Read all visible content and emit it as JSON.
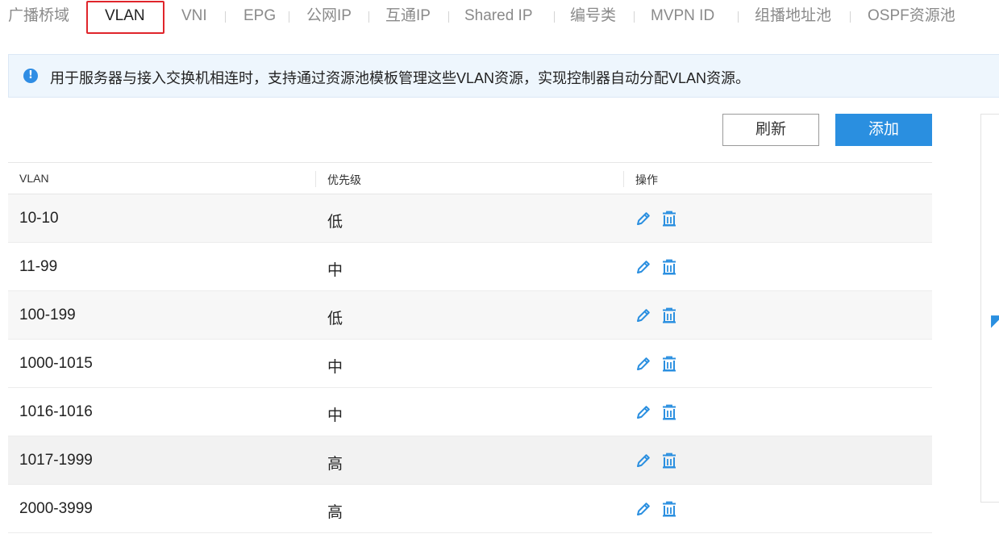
{
  "tabs": [
    {
      "label": "广播桥域",
      "active": false
    },
    {
      "label": "VLAN",
      "active": true
    },
    {
      "label": "VNI",
      "active": false
    },
    {
      "label": "EPG",
      "active": false
    },
    {
      "label": "公网IP",
      "active": false
    },
    {
      "label": "互通IP",
      "active": false
    },
    {
      "label": "Shared IP",
      "active": false
    },
    {
      "label": "编号类",
      "active": false
    },
    {
      "label": "MVPN ID",
      "active": false
    },
    {
      "label": "组播地址池",
      "active": false
    },
    {
      "label": "OSPF资源池",
      "active": false
    }
  ],
  "notice": {
    "icon": "info-icon",
    "text": "用于服务器与接入交换机相连时，支持通过资源池模板管理这些VLAN资源，实现控制器自动分配VLAN资源。"
  },
  "toolbar": {
    "refresh_label": "刷新",
    "add_label": "添加"
  },
  "table": {
    "columns": [
      "VLAN",
      "优先级",
      "操作"
    ],
    "rows": [
      {
        "vlan": "10-10",
        "priority": "低"
      },
      {
        "vlan": "11-99",
        "priority": "中"
      },
      {
        "vlan": "100-199",
        "priority": "低"
      },
      {
        "vlan": "1000-1015",
        "priority": "中"
      },
      {
        "vlan": "1016-1016",
        "priority": "中"
      },
      {
        "vlan": "1017-1999",
        "priority": "高"
      },
      {
        "vlan": "2000-3999",
        "priority": "高"
      }
    ],
    "action_icons": [
      "edit-icon",
      "delete-icon"
    ]
  },
  "colors": {
    "accent": "#2a8fe0",
    "active_tab_border": "#e0252b",
    "notice_bg": "#eef6fd"
  }
}
